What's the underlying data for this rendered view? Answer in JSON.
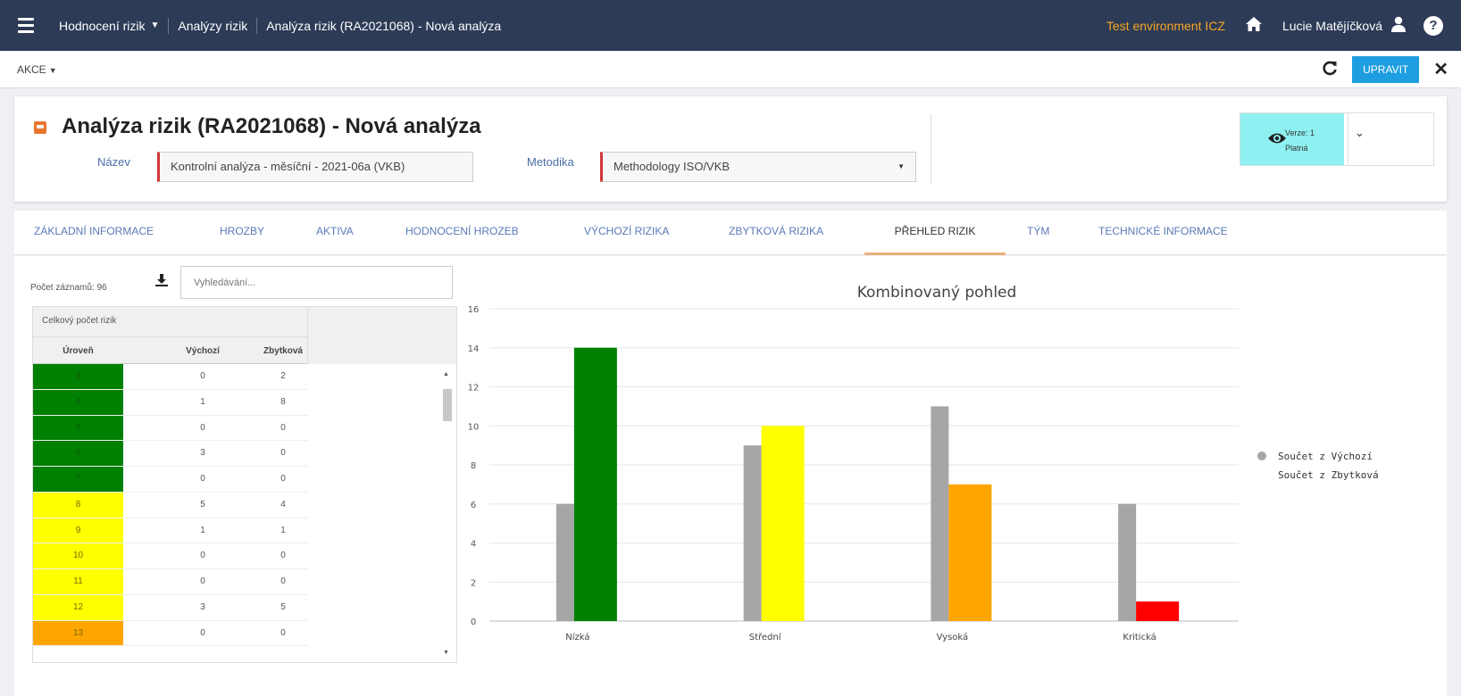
{
  "topbar": {
    "crumbs": [
      "Hodnocení rizik",
      "Analýzy rizik",
      "Analýza rizik (RA2021068) - Nová analýza"
    ],
    "test_env": "Test environment ICZ",
    "user": "Lucie Matějíčková",
    "help": "?"
  },
  "actionbar": {
    "akce": "AKCE",
    "edit_label": "UPRAVIT"
  },
  "header": {
    "title": "Analýza rizik (RA2021068) - Nová analýza",
    "name_label": "Název",
    "name_value": "Kontrolní analýza - měsíční - 2021-06a (VKB)",
    "method_label": "Metodika",
    "method_value": "Methodology ISO/VKB",
    "version_line": "Verze: 1",
    "status_line": "Platná"
  },
  "tabs": [
    "ZÁKLADNÍ INFORMACE",
    "HROZBY",
    "AKTIVA",
    "HODNOCENÍ HROZEB",
    "VÝCHOZÍ RIZIKA",
    "ZBYTKOVÁ RIZIKA",
    "PŘEHLED RIZIK",
    "TÝM",
    "TECHNICKÉ INFORMACE"
  ],
  "active_tab": "PŘEHLED RIZIK",
  "table": {
    "count_label": "Počet záznamů: 96",
    "search_placeholder": "Vyhledávání...",
    "group_header": "Celkový počet rizik",
    "columns": [
      "Úroveň",
      "Výchozí",
      "Zbytková"
    ],
    "rows": [
      {
        "level": "3",
        "color": "#008000",
        "vychozi": "0",
        "zbytkova": "2"
      },
      {
        "level": "4",
        "color": "#008000",
        "vychozi": "1",
        "zbytkova": "8"
      },
      {
        "level": "5",
        "color": "#008000",
        "vychozi": "0",
        "zbytkova": "0"
      },
      {
        "level": "6",
        "color": "#008000",
        "vychozi": "3",
        "zbytkova": "0"
      },
      {
        "level": "7",
        "color": "#008000",
        "vychozi": "0",
        "zbytkova": "0"
      },
      {
        "level": "8",
        "color": "#ffff00",
        "vychozi": "5",
        "zbytkova": "4"
      },
      {
        "level": "9",
        "color": "#ffff00",
        "vychozi": "1",
        "zbytkova": "1"
      },
      {
        "level": "10",
        "color": "#ffff00",
        "vychozi": "0",
        "zbytkova": "0"
      },
      {
        "level": "11",
        "color": "#ffff00",
        "vychozi": "0",
        "zbytkova": "0"
      },
      {
        "level": "12",
        "color": "#ffff00",
        "vychozi": "3",
        "zbytkova": "5"
      },
      {
        "level": "13",
        "color": "#ffa500",
        "vychozi": "0",
        "zbytkova": "0"
      }
    ]
  },
  "chart_data": {
    "type": "bar",
    "title": "Kombinovaný pohled",
    "categories": [
      "Nízká",
      "Střední",
      "Vysoká",
      "Kritická"
    ],
    "series": [
      {
        "name": "Součet z Výchozí",
        "values": [
          6,
          9,
          11,
          6
        ],
        "colors": [
          "#a6a6a6",
          "#a6a6a6",
          "#a6a6a6",
          "#a6a6a6"
        ]
      },
      {
        "name": "Součet z Zbytková",
        "values": [
          14,
          10,
          7,
          1
        ],
        "colors": [
          "#008000",
          "#ffff00",
          "#ffa500",
          "#ff0000"
        ]
      }
    ],
    "ylim": [
      0,
      16
    ],
    "yticks": [
      0,
      2,
      4,
      6,
      8,
      10,
      12,
      14,
      16
    ],
    "grid": true,
    "legend": "right"
  }
}
